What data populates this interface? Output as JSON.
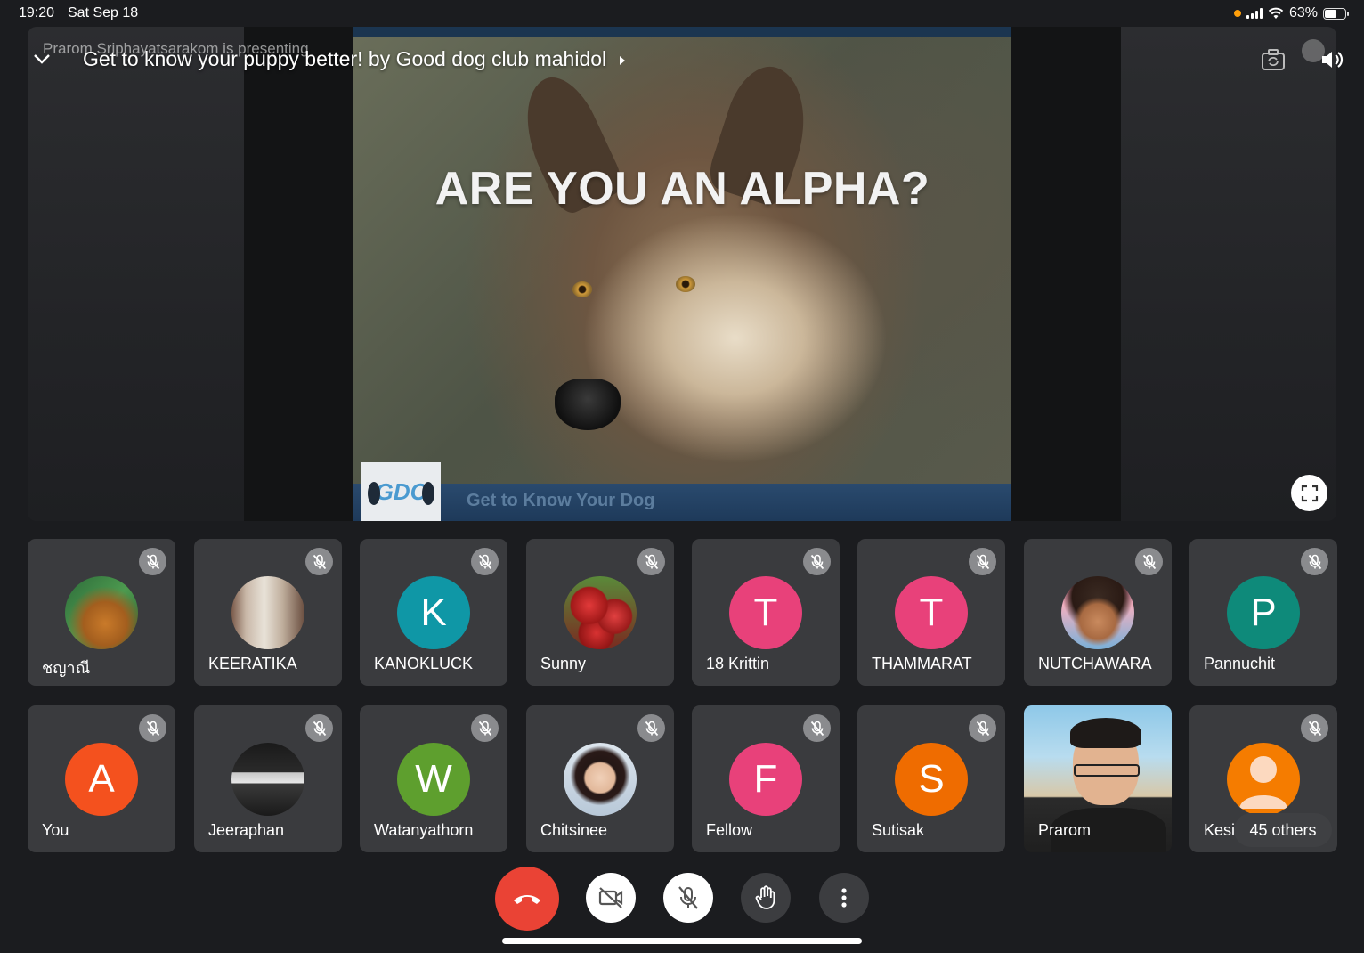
{
  "status_bar": {
    "time": "19:20",
    "date": "Sat Sep 18",
    "battery": "63%",
    "battery_level": 0.63
  },
  "presentation": {
    "presenting_label": "Prarom Sriphayatsarakom is presenting",
    "title": "Get to know your puppy better! by Good dog club mahidol",
    "slide_heading": "ARE YOU AN ALPHA?",
    "slide_footer": "Get to Know Your Dog",
    "slide_logo": "GDC"
  },
  "participants": [
    {
      "name": "ชญาณี",
      "avatar_type": "photo",
      "avatar_desc": "elephant-photo",
      "muted": true
    },
    {
      "name": "KEERATIKA",
      "avatar_type": "photo",
      "avatar_desc": "store-aisle-photo",
      "muted": true
    },
    {
      "name": "KANOKLUCK",
      "avatar_type": "initial",
      "initial": "K",
      "color": "#0f97a6",
      "muted": true
    },
    {
      "name": "Sunny",
      "avatar_type": "photo",
      "avatar_desc": "apples-photo",
      "muted": true
    },
    {
      "name": "18 Krittin",
      "avatar_type": "initial",
      "initial": "T",
      "color": "#e8417a",
      "muted": true
    },
    {
      "name": "THAMMARAT",
      "avatar_type": "initial",
      "initial": "T",
      "color": "#e8417a",
      "muted": true
    },
    {
      "name": "NUTCHAWARA",
      "avatar_type": "photo",
      "avatar_desc": "cartoon-girl-photo",
      "muted": true
    },
    {
      "name": "Pannuchit",
      "avatar_type": "initial",
      "initial": "P",
      "color": "#0e8a7a",
      "muted": true
    },
    {
      "name": "You",
      "avatar_type": "initial",
      "initial": "A",
      "color": "#f4511e",
      "muted": true
    },
    {
      "name": "Jeeraphan",
      "avatar_type": "photo",
      "avatar_desc": "storefront-photo",
      "muted": true
    },
    {
      "name": "Watanyathorn",
      "avatar_type": "initial",
      "initial": "W",
      "color": "#5e9f2e",
      "muted": true
    },
    {
      "name": "Chitsinee",
      "avatar_type": "photo",
      "avatar_desc": "selfie-photo",
      "muted": true
    },
    {
      "name": "Fellow",
      "avatar_type": "initial",
      "initial": "F",
      "color": "#e8417a",
      "muted": true
    },
    {
      "name": "Sutisak",
      "avatar_type": "initial",
      "initial": "S",
      "color": "#ef6c00",
      "muted": true
    },
    {
      "name": "Prarom",
      "avatar_type": "video",
      "muted": false
    },
    {
      "name": "Kesi",
      "avatar_type": "generic",
      "color": "#f57c00",
      "muted": true
    }
  ],
  "others_label": "45 others",
  "controls": {
    "end_call_color": "#ea4335"
  }
}
